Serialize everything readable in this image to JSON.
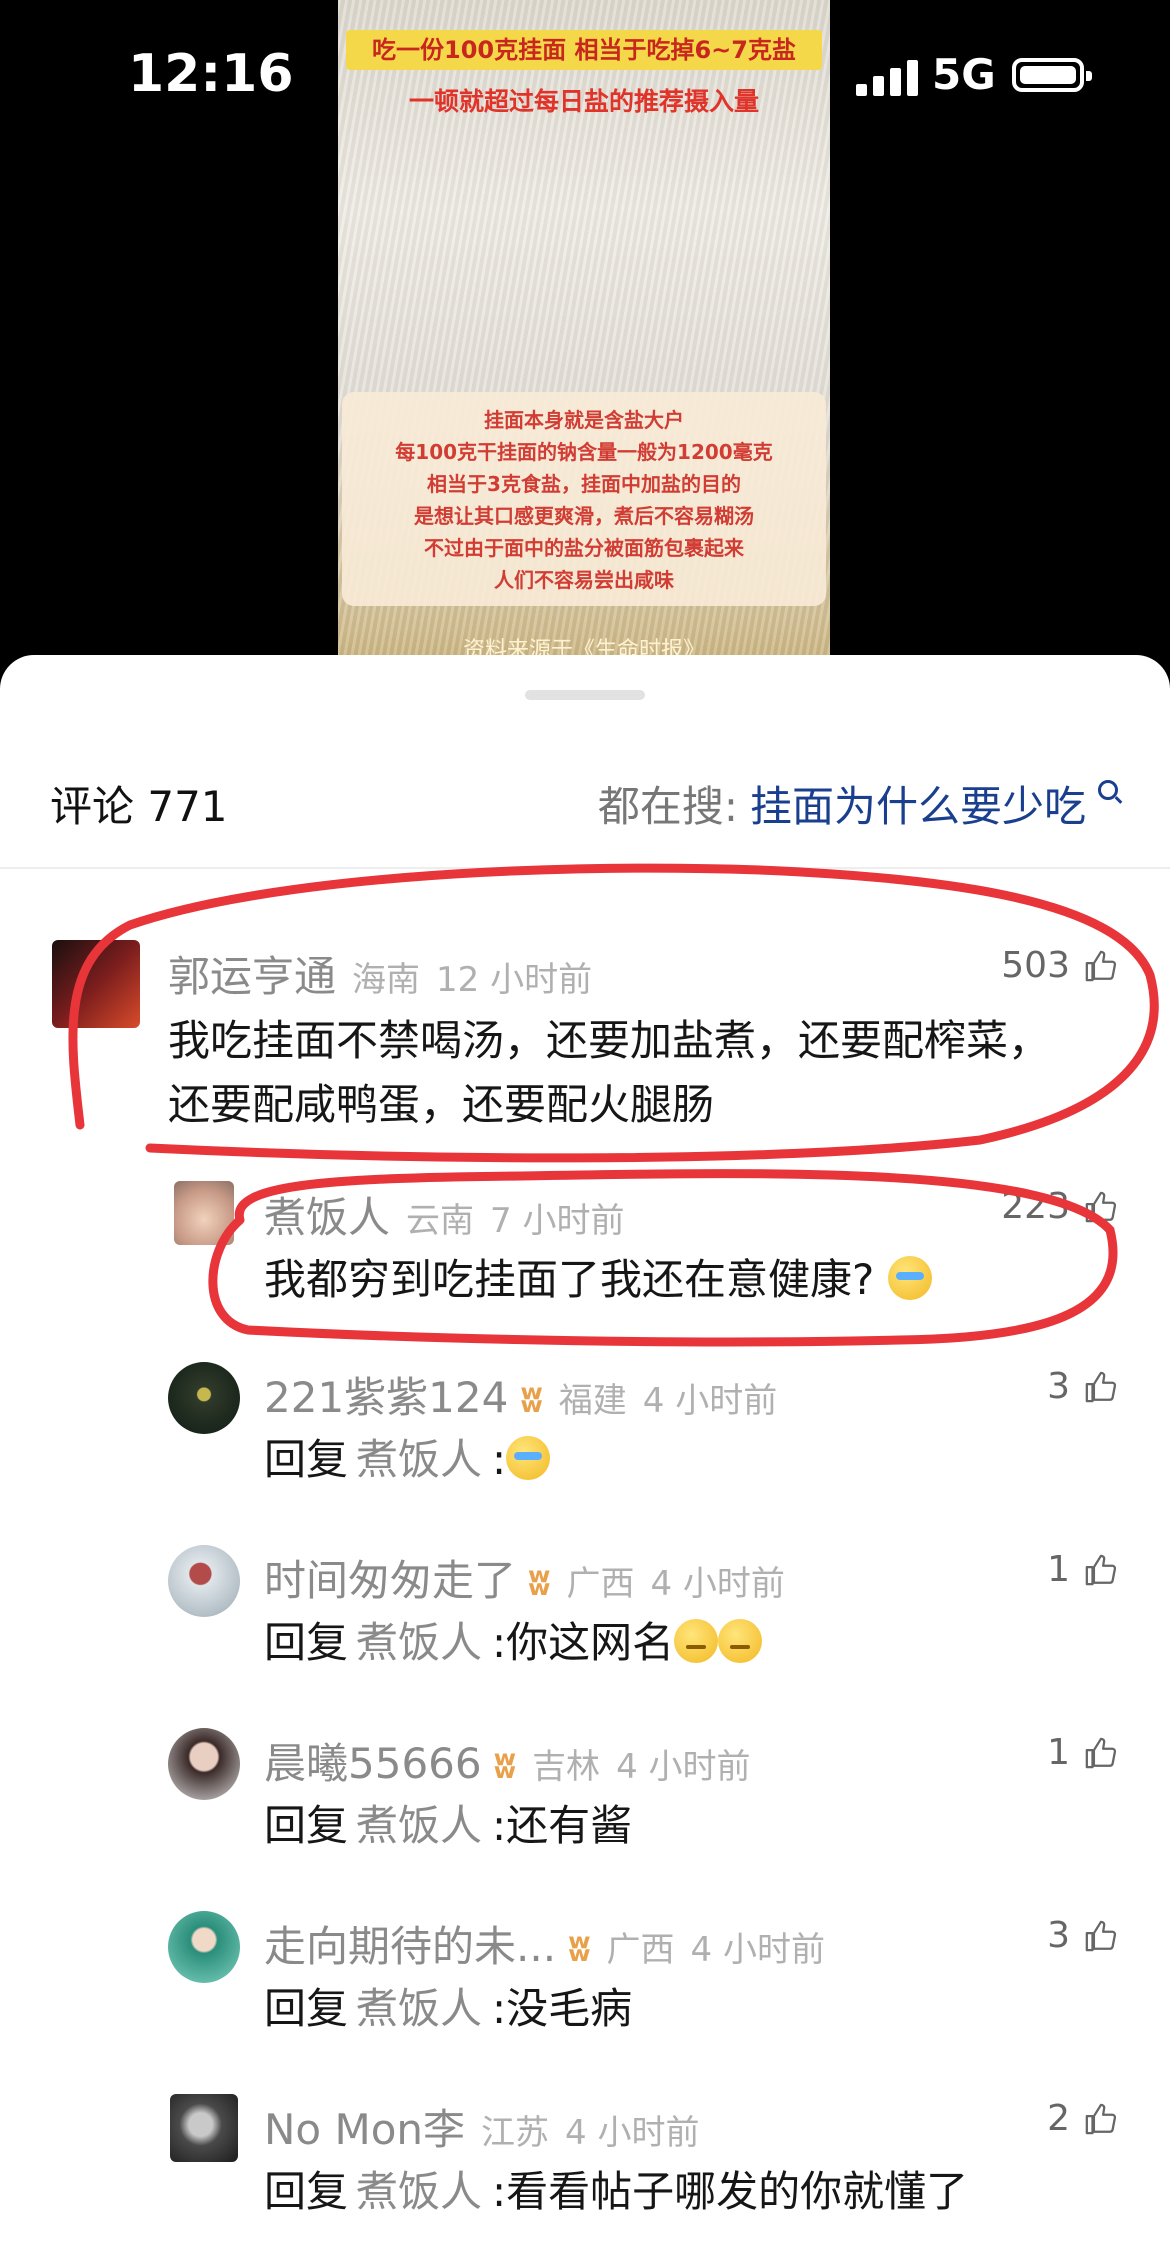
{
  "status_bar": {
    "time": "12:16",
    "network": "5G"
  },
  "video": {
    "banner_top": "吃一份100克挂面 相当于吃掉6~7克盐",
    "banner_sub": "一顿就超过每日盐的推荐摄入量",
    "caption_lines": [
      "挂面本身就是含盐大户",
      "每100克干挂面的钠含量一般为1200毫克",
      "相当于3克食盐，挂面中加盐的目的",
      "是想让其口感更爽滑，煮后不容易糊汤",
      "不过由于面中的盐分被面筋包裹起来",
      "人们不容易尝出咸味"
    ],
    "source": "资料来源于《生命时报》"
  },
  "header": {
    "comments_label": "评论 771",
    "search_label": "都在搜:",
    "search_query": "挂面为什么要少吃"
  },
  "colors": {
    "link": "#1a3f8f",
    "highlight": "#e8353a",
    "badge": "#e8a14a"
  },
  "comments": [
    {
      "name": "郭运亨通",
      "location": "海南",
      "time": "12 小时前",
      "likes": "503",
      "text_line1": "我吃挂面不禁喝汤，还要加盐煮，还要配榨菜，",
      "text_line2": "还要配咸鸭蛋，还要配火腿肠"
    },
    {
      "name": "煮饭人",
      "location": "云南",
      "time": "7 小时前",
      "likes": "223",
      "text": "我都穷到吃挂面了我还在意健康?"
    },
    {
      "name": "221紫紫124",
      "location": "福建",
      "time": "4 小时前",
      "likes": "3",
      "reply_prefix": "回复",
      "reply_to": "煮饭人",
      "text": ":"
    },
    {
      "name": "时间匆匆走了",
      "location": "广西",
      "time": "4 小时前",
      "likes": "1",
      "reply_prefix": "回复",
      "reply_to": "煮饭人",
      "text": ":你这网名"
    },
    {
      "name": "晨曦55666",
      "location": "吉林",
      "time": "4 小时前",
      "likes": "1",
      "reply_prefix": "回复",
      "reply_to": "煮饭人",
      "text": ":还有酱"
    },
    {
      "name": "走向期待的未...",
      "location": "广西",
      "time": "4 小时前",
      "likes": "3",
      "reply_prefix": "回复",
      "reply_to": "煮饭人",
      "text": ":没毛病"
    },
    {
      "name": "No Mon李",
      "location": "江苏",
      "time": "4 小时前",
      "likes": "2",
      "reply_prefix": "回复",
      "reply_to": "煮饭人",
      "text": ":看看帖子哪发的你就懂了"
    }
  ]
}
